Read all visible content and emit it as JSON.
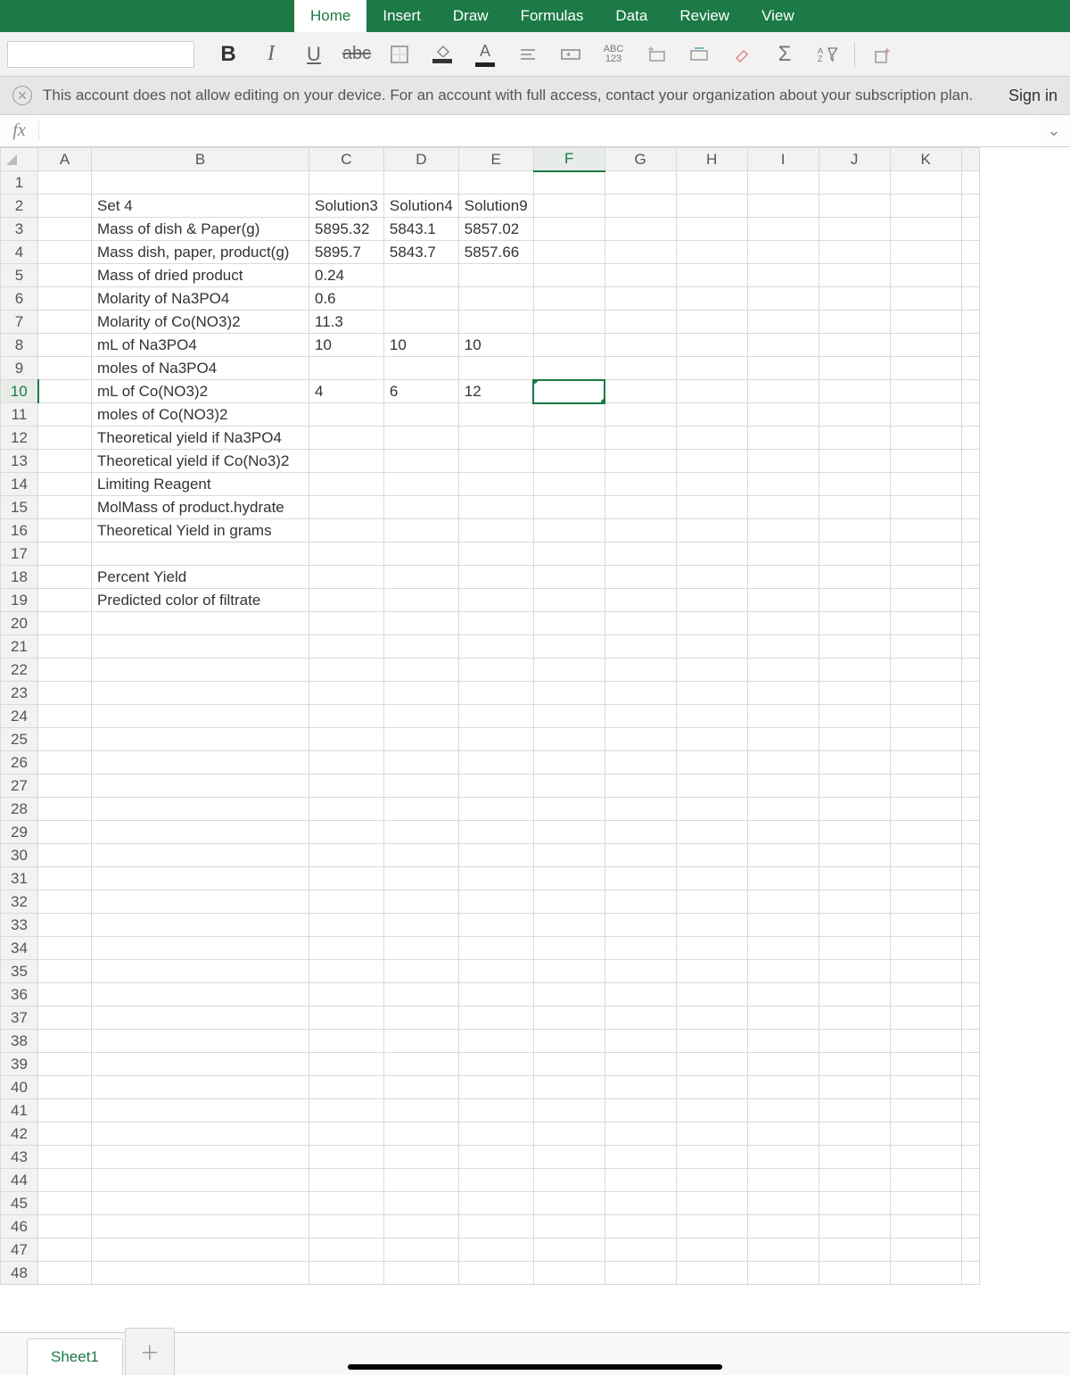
{
  "ribbon": {
    "tabs": [
      "Home",
      "Insert",
      "Draw",
      "Formulas",
      "Data",
      "Review",
      "View"
    ],
    "active": "Home"
  },
  "toolbar": {
    "bold": "B",
    "italic": "I",
    "underline": "U",
    "strike": "abc",
    "font_letter": "A",
    "abc123_top": "ABC",
    "abc123_bot": "123",
    "sigma": "Σ"
  },
  "banner": {
    "text": "This account does not allow editing on your device. For an account with full access, contact your organization about your subscription plan.",
    "signin": "Sign in"
  },
  "formula_bar": {
    "fx": "fx",
    "value": ""
  },
  "columns": [
    "A",
    "B",
    "C",
    "D",
    "E",
    "F",
    "G",
    "H",
    "I",
    "J",
    "K"
  ],
  "selected_col": "F",
  "selected_row": 10,
  "active_cell": "F10",
  "rows": [
    {
      "n": 1
    },
    {
      "n": 2,
      "B": "Set 4",
      "C": "Solution3",
      "D": "Solution4",
      "E": "Solution9"
    },
    {
      "n": 3,
      "B": "Mass of dish & Paper(g)",
      "C": "5895.32",
      "D": "5843.1",
      "E": "5857.02"
    },
    {
      "n": 4,
      "B": "Mass dish, paper, product(g)",
      "C": "5895.7",
      "D": "5843.7",
      "E": "5857.66"
    },
    {
      "n": 5,
      "B": "Mass of dried product",
      "C": "0.24"
    },
    {
      "n": 6,
      "B": "Molarity of Na3PO4",
      "C": "0.6"
    },
    {
      "n": 7,
      "B": "Molarity of Co(NO3)2",
      "C": "11.3"
    },
    {
      "n": 8,
      "B": "mL of Na3PO4",
      "C": "10",
      "D": "10",
      "E": "10"
    },
    {
      "n": 9,
      "B": "moles of Na3PO4"
    },
    {
      "n": 10,
      "B": "mL of Co(NO3)2",
      "C": "4",
      "D": "6",
      "E": "12"
    },
    {
      "n": 11,
      "B": "moles of Co(NO3)2"
    },
    {
      "n": 12,
      "B": "Theoretical yield if Na3PO4"
    },
    {
      "n": 13,
      "B": "Theoretical yield if Co(No3)2"
    },
    {
      "n": 14,
      "B": "Limiting Reagent"
    },
    {
      "n": 15,
      "B": "MolMass of product.hydrate"
    },
    {
      "n": 16,
      "B": "Theoretical Yield in grams"
    },
    {
      "n": 17
    },
    {
      "n": 18,
      "B": "Percent Yield"
    },
    {
      "n": 19,
      "B": "Predicted color of filtrate"
    },
    {
      "n": 20
    },
    {
      "n": 21
    },
    {
      "n": 22
    },
    {
      "n": 23
    },
    {
      "n": 24
    },
    {
      "n": 25
    },
    {
      "n": 26
    },
    {
      "n": 27
    },
    {
      "n": 28
    },
    {
      "n": 29
    },
    {
      "n": 30
    },
    {
      "n": 31
    },
    {
      "n": 32
    },
    {
      "n": 33
    },
    {
      "n": 34
    },
    {
      "n": 35
    },
    {
      "n": 36
    },
    {
      "n": 37
    },
    {
      "n": 38
    },
    {
      "n": 39
    },
    {
      "n": 40
    },
    {
      "n": 41
    },
    {
      "n": 42
    },
    {
      "n": 43
    },
    {
      "n": 44
    },
    {
      "n": 45
    },
    {
      "n": 46
    },
    {
      "n": 47
    },
    {
      "n": 48
    }
  ],
  "sheets": {
    "active": "Sheet1"
  }
}
